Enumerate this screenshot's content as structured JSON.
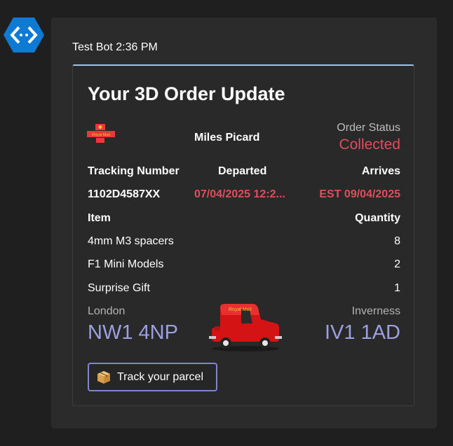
{
  "bot": {
    "avatar_icon": "bot-code-icon"
  },
  "message": {
    "sender_time": "Test Bot 2:36 PM"
  },
  "card": {
    "title": "Your 3D Order Update",
    "logo_icon": "royal-mail-logo-icon",
    "logo_text": "Royal Mail",
    "recipient": "Miles Picard",
    "status_label": "Order Status",
    "status_value": "Collected",
    "headers": {
      "tracking": "Tracking Number",
      "departed": "Departed",
      "arrives": "Arrives"
    },
    "tracking_number": "1102D4587XX",
    "departed": "07/04/2025 12:2...",
    "arrives": "EST 09/04/2025",
    "items_header": {
      "item": "Item",
      "quantity": "Quantity"
    },
    "items": [
      {
        "name": "4mm M3 spacers",
        "qty": "8"
      },
      {
        "name": "F1 Mini Models",
        "qty": "2"
      },
      {
        "name": "Surprise Gift",
        "qty": "1"
      }
    ],
    "origin": {
      "city": "London",
      "postcode": "NW1 4NP"
    },
    "destination": {
      "city": "Inverness",
      "postcode": "IV1 1AD"
    },
    "van_icon": "royal-mail-van-icon",
    "van_text": "Royal Mail",
    "track_button": {
      "icon": "parcel-icon",
      "label": "Track your parcel"
    }
  },
  "colors": {
    "accent_red": "#e04d5c",
    "postcode_purple": "#9c9fe0",
    "button_border": "#7f86cc",
    "avatar_blue": "#0f7ad4"
  }
}
